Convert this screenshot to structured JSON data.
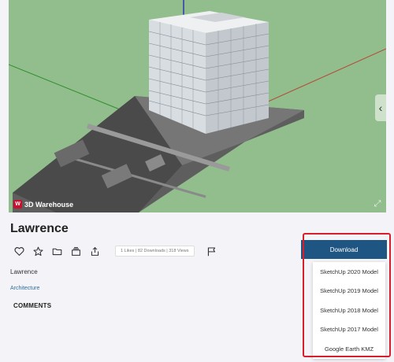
{
  "viewer": {
    "logo_text": "3D Warehouse",
    "logo_mark": "W",
    "toggle_icon": "chevron-left-icon",
    "fullscreen_icon": "expand-icon"
  },
  "model": {
    "title": "Lawrence",
    "stats": "1 Likes | 82 Downloads | 318 Views",
    "description": "Lawrence",
    "category": "Architecture",
    "comments_heading": "COMMENTS"
  },
  "actions": [
    "heart-icon",
    "star-icon",
    "folder-icon",
    "collection-icon",
    "share-icon",
    "flag-icon"
  ],
  "download": {
    "label": "Download",
    "options": [
      "SketchUp 2020 Model",
      "SketchUp 2019 Model",
      "SketchUp 2018 Model",
      "SketchUp 2017 Model",
      "Google Earth KMZ"
    ]
  },
  "colors": {
    "viewer_bg": "#92bd8c",
    "download_bg": "#1f5582",
    "highlight": "#d81e2a",
    "link": "#2f6c99"
  }
}
